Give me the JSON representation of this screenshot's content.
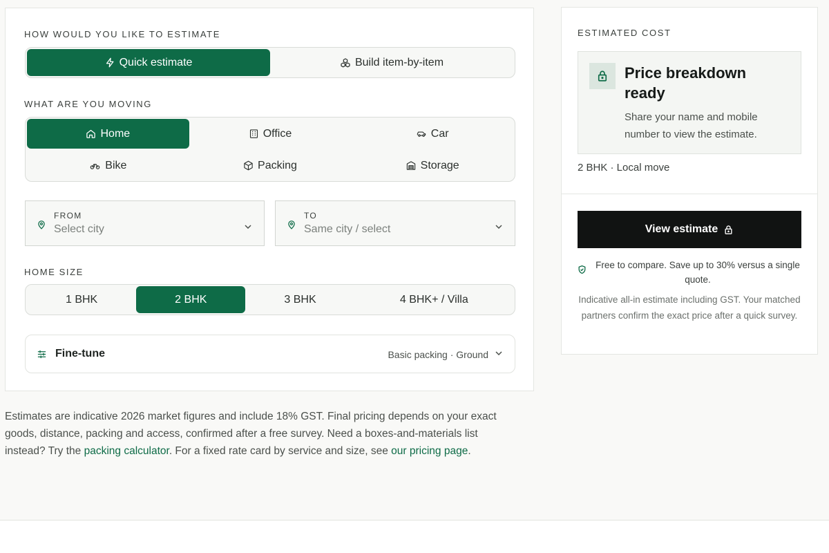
{
  "estimate_method": {
    "label": "HOW WOULD YOU LIKE TO ESTIMATE",
    "options": [
      {
        "label": "Quick estimate",
        "icon": "lightning-icon",
        "active": true
      },
      {
        "label": "Build item-by-item",
        "icon": "boxes-icon",
        "active": false
      }
    ]
  },
  "moving": {
    "label": "WHAT ARE YOU MOVING",
    "options": [
      {
        "label": "Home",
        "icon": "home-icon",
        "active": true
      },
      {
        "label": "Office",
        "icon": "building-icon",
        "active": false
      },
      {
        "label": "Car",
        "icon": "car-icon",
        "active": false
      },
      {
        "label": "Bike",
        "icon": "bike-icon",
        "active": false
      },
      {
        "label": "Packing",
        "icon": "package-icon",
        "active": false
      },
      {
        "label": "Storage",
        "icon": "warehouse-icon",
        "active": false
      }
    ]
  },
  "from": {
    "label": "FROM",
    "placeholder": "Select city"
  },
  "to": {
    "label": "TO",
    "placeholder": "Same city / select"
  },
  "home_size": {
    "label": "HOME SIZE",
    "options": [
      {
        "label": "1 BHK",
        "active": false
      },
      {
        "label": "2 BHK",
        "active": true
      },
      {
        "label": "3 BHK",
        "active": false
      },
      {
        "label": "4 BHK+ / Villa",
        "active": false
      }
    ]
  },
  "fine_tune": {
    "title": "Fine-tune",
    "summary": "Basic packing · Ground"
  },
  "footnote": {
    "text1": "Estimates are indicative 2026 market figures and include 18% GST. Final pricing depends on your exact goods, distance, packing and access, confirmed after a free survey. Need a boxes-and-materials list instead? Try the ",
    "link1": "packing calculator",
    "text2": ". For a fixed rate card by service and size, see ",
    "link2": "our pricing page",
    "text3": "."
  },
  "estimated_cost": {
    "label": "ESTIMATED COST",
    "locked_title": "Price breakdown ready",
    "locked_text": "Share your name and mobile number to view the estimate.",
    "move_summary": "2 BHK · Local move",
    "cta_label": "View estimate",
    "free_note": "Free to compare. Save up to 30% versus a single quote.",
    "indicative_note": "Indicative all-in estimate including GST. Your matched partners confirm the exact price after a quick survey."
  },
  "colors": {
    "accent": "#0e6b47",
    "cta": "#111312"
  }
}
